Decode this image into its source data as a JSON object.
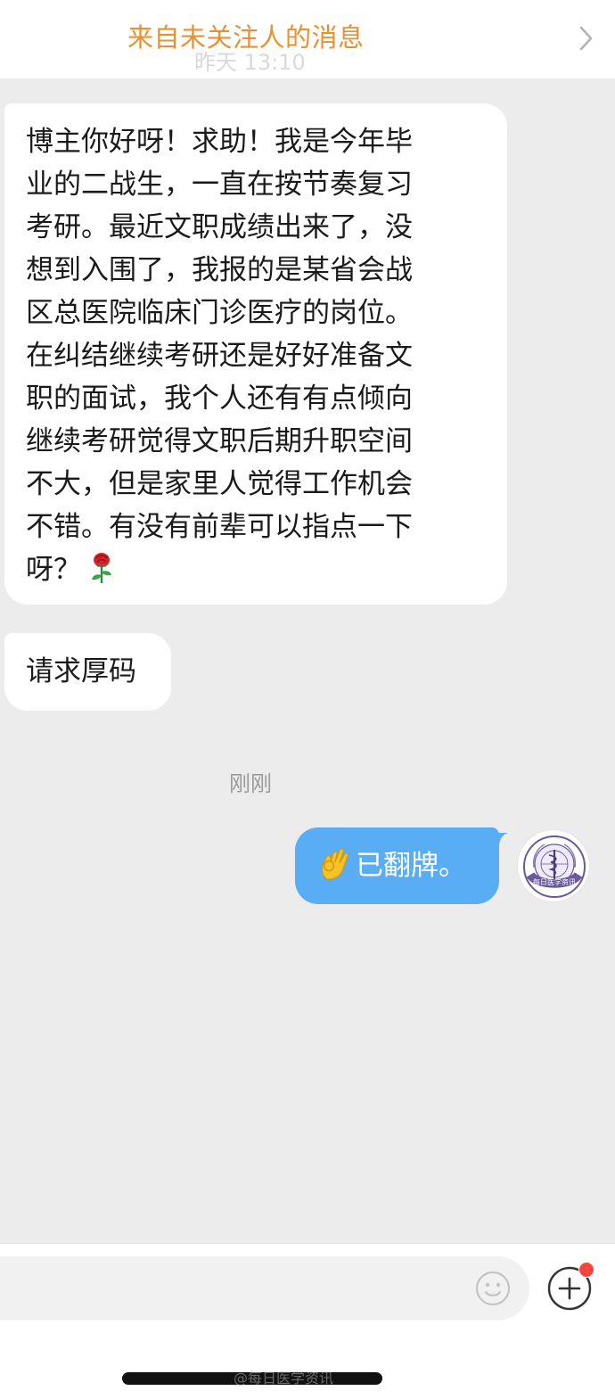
{
  "banner": {
    "title": "来自未关注人的消息",
    "ghost_time": "昨天 13:10",
    "chevron_icon": "chevron-right-icon",
    "title_color": "#e8912f"
  },
  "messages": [
    {
      "direction": "incoming",
      "text": "博主你好呀！求助！我是今年毕\n业的二战生，一直在按节奏复习\n考研。最近文职成绩出来了，没\n想到入围了，我报的是某省会战\n区总医院临床门诊医疗的岗位。\n在纠结继续考研还是好好准备文\n职的面试，我个人还有有点倾向\n继续考研觉得文职后期升职空间\n不大，但是家里人觉得工作机会\n不错。有没有前辈可以指点一下\n呀？",
      "emoji_icon": "rose-icon"
    },
    {
      "direction": "incoming",
      "text": "请求厚码"
    },
    {
      "direction": "outgoing",
      "emoji_icon": "ok-hand-icon",
      "text": "已翻牌。",
      "bubble_color": "#59adf5"
    }
  ],
  "timestamp": "刚刚",
  "avatar": {
    "icon": "medical-emblem-avatar-icon",
    "logo_text": "每日医学资讯"
  },
  "input_bar": {
    "placeholder": "",
    "emoji_button_icon": "smiley-face-icon",
    "plus_button_icon": "plus-circle-icon",
    "notification_dot_color": "#f5453e"
  },
  "watermark": "@每日医学资讯"
}
